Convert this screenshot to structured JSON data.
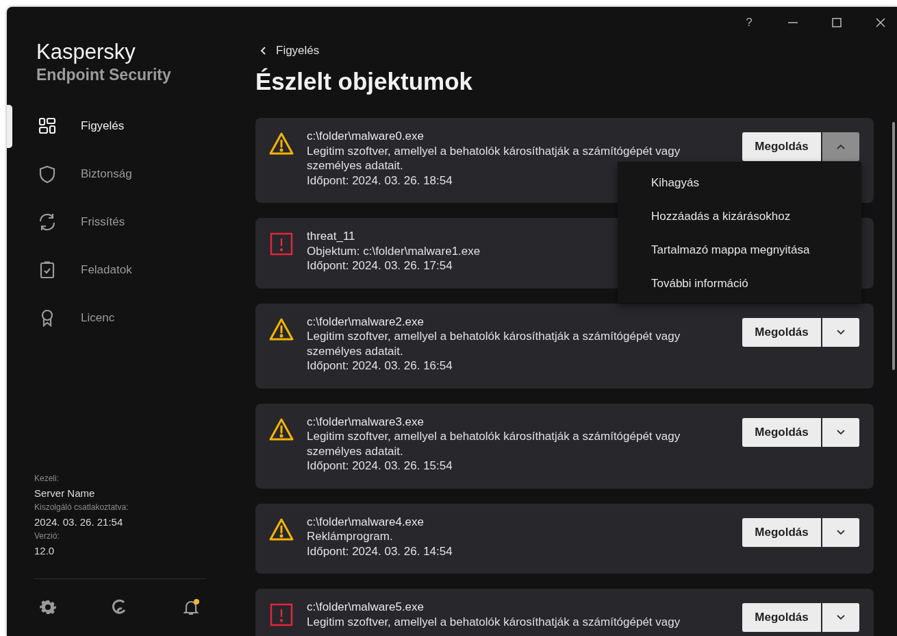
{
  "window": {
    "help": "?"
  },
  "sidebar": {
    "brand": "Kaspersky",
    "product": "Endpoint Security",
    "nav": [
      {
        "label": "Figyelés",
        "kind": "dashboard",
        "selected": true
      },
      {
        "label": "Biztonság",
        "kind": "shield",
        "selected": false
      },
      {
        "label": "Frissítés",
        "kind": "refresh",
        "selected": false
      },
      {
        "label": "Feladatok",
        "kind": "tasks",
        "selected": false
      },
      {
        "label": "Licenc",
        "kind": "license",
        "selected": false
      }
    ],
    "info": [
      {
        "label": "Kezeli:",
        "value": "Server Name"
      },
      {
        "label": "Kiszolgáló csatlakoztatva:",
        "value": "2024. 03. 26. 21:54"
      },
      {
        "label": "Verzió:",
        "value": "12.0"
      }
    ],
    "notification_badge": true
  },
  "main": {
    "breadcrumb": "Figyelés",
    "title": "Észlelt objektumok",
    "detections": [
      {
        "kind": "warning",
        "title": "c:\\folder\\malware0.exe",
        "lines": [
          "Legitim szoftver, amellyel a behatolók károsíthatják a számítógépét vagy személyes adatait.",
          "Időpont: 2024. 03. 26. 18:54"
        ],
        "action": "Megoldás",
        "expanded": true,
        "menu": [
          "Kihagyás",
          "Hozzáadás a kizárásokhoz",
          "Tartalmazó mappa megnyitása",
          "További információ"
        ]
      },
      {
        "kind": "danger",
        "title": "threat_11",
        "lines": [
          "Objektum: c:\\folder\\malware1.exe",
          "Időpont: 2024. 03. 26. 17:54"
        ]
      },
      {
        "kind": "warning",
        "title": "c:\\folder\\malware2.exe",
        "lines": [
          "Legitim szoftver, amellyel a behatolók károsíthatják a számítógépét vagy személyes adatait.",
          "Időpont: 2024. 03. 26. 16:54"
        ],
        "action": "Megoldás",
        "expanded": false
      },
      {
        "kind": "warning",
        "title": "c:\\folder\\malware3.exe",
        "lines": [
          "Legitim szoftver, amellyel a behatolók károsíthatják a számítógépét vagy személyes adatait.",
          "Időpont: 2024. 03. 26. 15:54"
        ],
        "action": "Megoldás",
        "expanded": false
      },
      {
        "kind": "warning",
        "title": "c:\\folder\\malware4.exe",
        "lines": [
          "Reklámprogram.",
          "Időpont: 2024. 03. 26. 14:54"
        ],
        "action": "Megoldás",
        "expanded": false
      },
      {
        "kind": "danger",
        "title": "c:\\folder\\malware5.exe",
        "lines": [
          "Legitim szoftver, amellyel a behatolók károsíthatják a számítógépét vagy"
        ],
        "action": "Megoldás",
        "expanded": false
      }
    ]
  }
}
